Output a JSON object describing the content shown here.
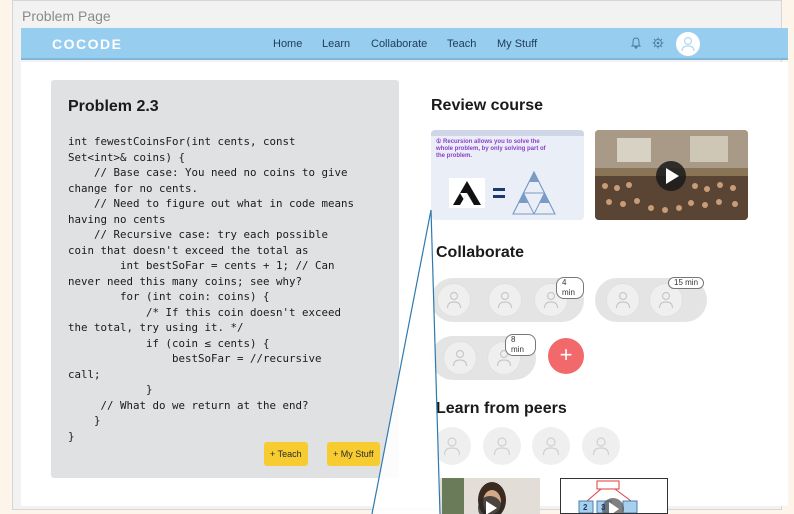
{
  "frame": {
    "title": "Problem Page"
  },
  "nav": {
    "logo": "COCODE",
    "links": [
      "Home",
      "Learn",
      "Collaborate",
      "Teach",
      "My Stuff"
    ],
    "icons": [
      "bell-icon",
      "gear-icon",
      "user-avatar-icon"
    ]
  },
  "problem": {
    "title": "Problem 2.3",
    "code": "int fewestCoinsFor(int cents, const\nSet<int>& coins) {\n    // Base case: You need no coins to give\nchange for no cents.\n    // Need to figure out what in code means\nhaving no cents\n    // Recursive case: try each possible\ncoin that doesn't exceed the total as\n        int bestSoFar = cents + 1; // Can\nnever need this many coins; see why?\n        for (int coin: coins) {\n            /* If this coin doesn't exceed\nthe total, try using it. */\n            if (coin ≤ cents) {\n                bestSoFar = //recursive\ncall;\n            }\n     // What do we return at the end?\n    }\n}",
    "teach_button": "+ Teach",
    "mystuff_button": "+ My Stuff"
  },
  "review": {
    "title": "Review course",
    "slide_text_line1": "① Recursion allows you to solve the",
    "slide_text_line2": "whole problem, by only solving part of",
    "slide_text_line3": "the problem.",
    "thumbnails": [
      "recursion-slide",
      "lecture-hall-video"
    ]
  },
  "collaborate": {
    "title": "Collaborate",
    "groups": [
      {
        "time": "4 min",
        "people": 3
      },
      {
        "time": "15 min",
        "people": 2
      },
      {
        "time": "8 min",
        "people": 2
      }
    ]
  },
  "peers": {
    "title": "Learn from peers",
    "avatars": 4,
    "videos": [
      "peer-video-person",
      "peer-video-diagram"
    ],
    "diagram_labels": [
      "2",
      "3"
    ]
  },
  "colors": {
    "navbar": "#97cdee",
    "button_yellow": "#f6cc31",
    "add_button": "#f1696a",
    "panel_gray": "#dfe1e3",
    "slide_purple": "#8d3fc9"
  }
}
